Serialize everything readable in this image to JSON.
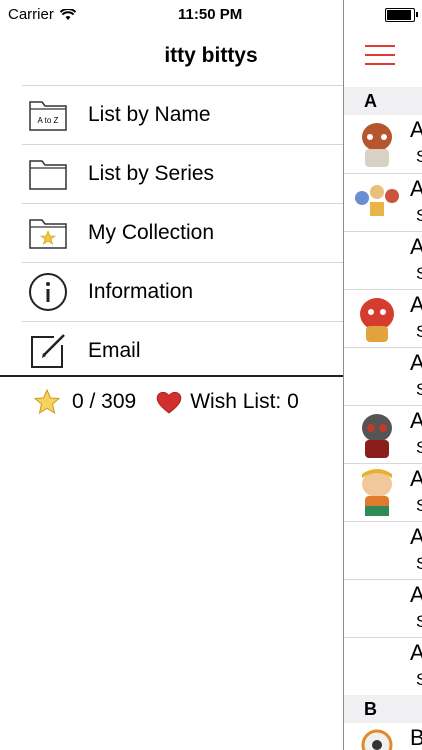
{
  "status": {
    "carrier": "Carrier",
    "time": "11:50 PM"
  },
  "menu": {
    "title": "itty bittys",
    "items": [
      {
        "label": "List by Name",
        "icon": "folder-a-to-z-icon",
        "icon_text": "A to Z"
      },
      {
        "label": "List by Series",
        "icon": "folder-icon"
      },
      {
        "label": "My Collection",
        "icon": "folder-star-icon"
      },
      {
        "label": "Information",
        "icon": "info-icon"
      },
      {
        "label": "Email",
        "icon": "compose-icon"
      }
    ]
  },
  "stats": {
    "collected": "0 / 309",
    "wishlist": "Wish List: 0"
  },
  "panel": {
    "sections": [
      {
        "letter": "A",
        "rows": [
          {
            "name": "A",
            "sub": "S"
          },
          {
            "name": "A",
            "sub": "S"
          },
          {
            "name": "A",
            "sub": "S"
          },
          {
            "name": "A",
            "sub": "S"
          },
          {
            "name": "A",
            "sub": "S"
          },
          {
            "name": "A",
            "sub": "S"
          },
          {
            "name": "A",
            "sub": "S"
          },
          {
            "name": "A",
            "sub": "S"
          },
          {
            "name": "A",
            "sub": "S"
          },
          {
            "name": "A",
            "sub": "S"
          }
        ]
      },
      {
        "letter": "B",
        "rows": [
          {
            "name": "B",
            "sub": ""
          }
        ]
      }
    ]
  },
  "colors": {
    "accent": "#e53935",
    "heart": "#d32f2f",
    "star": "#f6c33b"
  }
}
